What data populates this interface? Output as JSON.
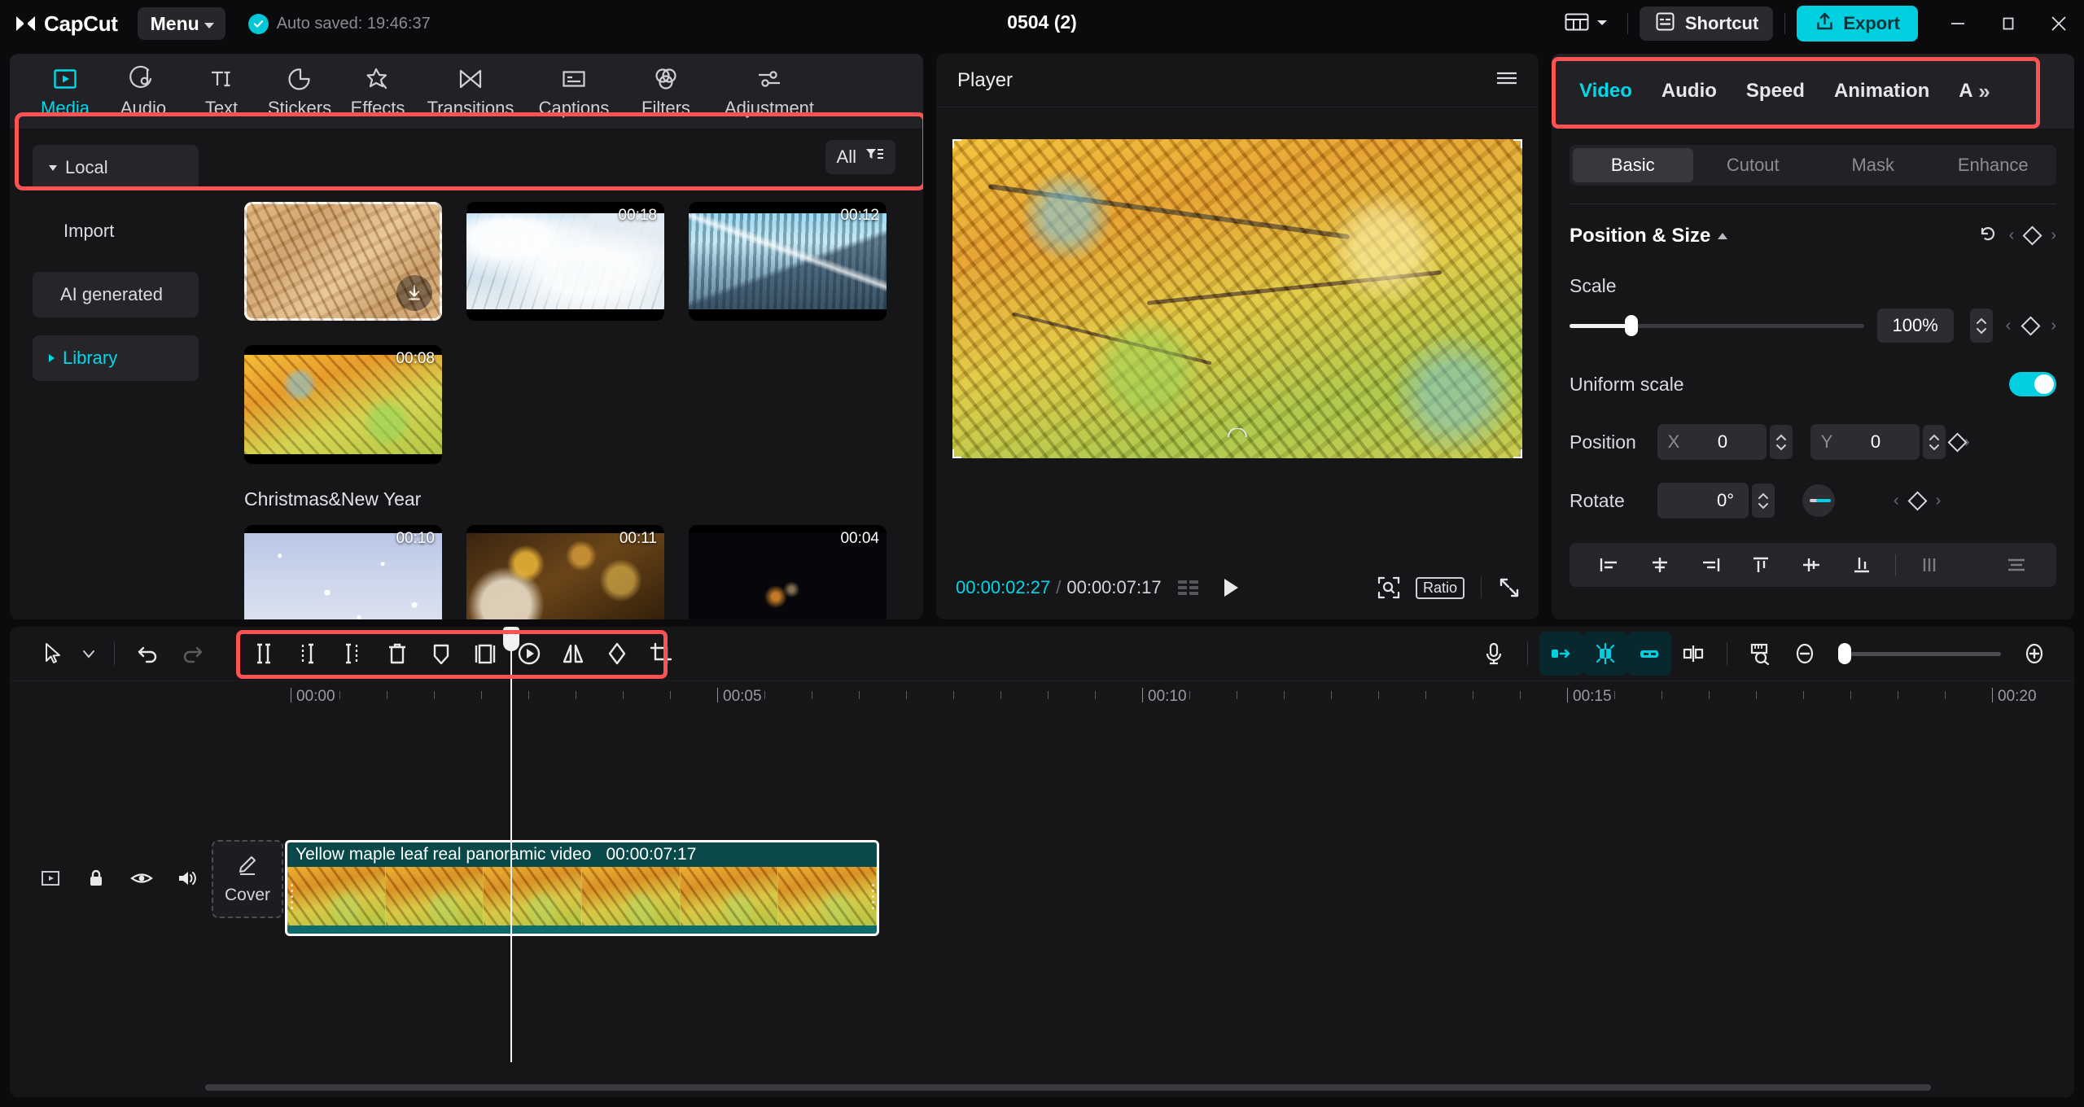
{
  "titlebar": {
    "brand": "CapCut",
    "menu_label": "Menu",
    "autosave_text": "Auto saved: 19:46:37",
    "project_title": "0504 (2)",
    "shortcut_label": "Shortcut",
    "export_label": "Export",
    "layout_icon": "layout-grid-icon",
    "minimize_icon": "minimize-icon",
    "maximize_icon": "maximize-icon",
    "close_icon": "close-icon"
  },
  "media_panel": {
    "highlight_color": "#fb5252",
    "tabs": [
      {
        "label": "Media",
        "icon": "media-play-icon",
        "active": true
      },
      {
        "label": "Audio",
        "icon": "audio-note-icon",
        "active": false
      },
      {
        "label": "Text",
        "icon": "text-ti-icon",
        "active": false
      },
      {
        "label": "Stickers",
        "icon": "sticker-icon",
        "active": false
      },
      {
        "label": "Effects",
        "icon": "effects-star-icon",
        "active": false
      },
      {
        "label": "Transitions",
        "icon": "transitions-bowtie-icon",
        "active": false
      },
      {
        "label": "Captions",
        "icon": "captions-icon",
        "active": false
      },
      {
        "label": "Filters",
        "icon": "filters-circles-icon",
        "active": false
      },
      {
        "label": "Adjustment",
        "icon": "adjustment-sliders-icon",
        "active": false
      }
    ],
    "sidebar": [
      {
        "label": "Local",
        "state": "expanded",
        "style": "box",
        "accent": false
      },
      {
        "label": "Import",
        "state": "none",
        "style": "plain",
        "accent": false
      },
      {
        "label": "AI generated",
        "state": "none",
        "style": "box",
        "accent": false
      },
      {
        "label": "Library",
        "state": "collapsed",
        "style": "box",
        "accent": true
      }
    ],
    "filter": {
      "label": "All",
      "icon": "filter-icon"
    },
    "local_items": [
      {
        "duration": "",
        "thumb": "t-wood",
        "download": true,
        "selected": true
      },
      {
        "duration": "00:18",
        "thumb": "t-snowtree",
        "download": false,
        "selected": false
      },
      {
        "duration": "00:12",
        "thumb": "t-mount",
        "download": false,
        "selected": false
      },
      {
        "duration": "00:08",
        "thumb": "t-maple",
        "download": false,
        "selected": false
      }
    ],
    "category_label": "Christmas&New Year",
    "category_items": [
      {
        "duration": "00:10",
        "thumb": "t-snowfall"
      },
      {
        "duration": "00:11",
        "thumb": "t-bokeh"
      },
      {
        "duration": "00:04",
        "thumb": "t-sparks"
      }
    ]
  },
  "player": {
    "title": "Player",
    "menu_icon": "hamburger-icon",
    "current_time": "00:00:02:27",
    "time_separator": "/",
    "total_time": "00:00:07:17",
    "grid_icon": "frames-grid-icon",
    "play_icon": "play-icon",
    "zoom_fit_icon": "zoom-fit-icon",
    "ratio_label": "Ratio",
    "fullscreen_icon": "fullscreen-icon"
  },
  "properties": {
    "highlight_color": "#fb5252",
    "tabs": [
      {
        "label": "Video",
        "active": true
      },
      {
        "label": "Audio",
        "active": false
      },
      {
        "label": "Speed",
        "active": false
      },
      {
        "label": "Animation",
        "active": false
      },
      {
        "label": "A",
        "active": false
      }
    ],
    "more_icon": "chevron-double-right-icon",
    "subtabs": [
      {
        "label": "Basic",
        "active": true
      },
      {
        "label": "Cutout",
        "active": false
      },
      {
        "label": "Mask",
        "active": false
      },
      {
        "label": "Enhance",
        "active": false
      }
    ],
    "section": {
      "title": "Position & Size",
      "collapse_icon": "chevron-up-icon",
      "reset_icon": "reset-icon",
      "keyframe_icon": "keyframe-diamond-icon"
    },
    "scale": {
      "label": "Scale",
      "value": "100%",
      "slider_percent": 21
    },
    "uniform_scale": {
      "label": "Uniform scale",
      "enabled": true
    },
    "position": {
      "label": "Position",
      "x_axis": "X",
      "x_value": "0",
      "y_axis": "Y",
      "y_value": "0"
    },
    "rotate": {
      "label": "Rotate",
      "value": "0°"
    },
    "align_buttons": [
      "align-left-icon",
      "align-center-horizontal-icon",
      "align-right-icon",
      "align-top-icon",
      "align-middle-vertical-icon",
      "align-bottom-icon",
      "distribute-horizontal-icon",
      "distribute-vertical-icon"
    ]
  },
  "timeline": {
    "highlight_color": "#fb5252",
    "left_tools": [
      {
        "icon": "select-arrow-icon",
        "state": "normal"
      },
      {
        "icon": "chevron-down-small-icon",
        "state": "normal"
      },
      {
        "icon": "undo-icon",
        "state": "normal"
      },
      {
        "icon": "redo-icon",
        "state": "disabled"
      }
    ],
    "edit_tools": [
      "split-icon",
      "delete-left-icon",
      "delete-right-icon",
      "trash-icon",
      "keyframe-marker-icon",
      "crop-frame-icon",
      "speed-curve-icon",
      "mirror-icon",
      "rotate-shape-icon",
      "crop-icon"
    ],
    "right_tools": [
      {
        "icon": "microphone-icon",
        "state": "normal"
      },
      {
        "icon": "snap-left-icon",
        "state": "active"
      },
      {
        "icon": "auto-snap-icon",
        "state": "active-strong"
      },
      {
        "icon": "link-icon",
        "state": "active"
      },
      {
        "icon": "split-playhead-icon",
        "state": "normal"
      },
      {
        "icon": "ruler-zoom-icon",
        "state": "normal"
      },
      {
        "icon": "zoom-out-icon",
        "state": "normal"
      },
      {
        "icon": "zoom-in-icon",
        "state": "normal"
      }
    ],
    "ruler_labels": [
      "00:00",
      "00:05",
      "00:10",
      "00:15",
      "00:20"
    ],
    "playhead_time": "00:00:02:27",
    "track_controls": [
      "track-type-icon",
      "lock-icon",
      "eye-icon",
      "volume-icon"
    ],
    "cover": {
      "label": "Cover",
      "icon": "pencil-icon"
    },
    "clip": {
      "name": "Yellow maple leaf real panoramic video",
      "duration": "00:00:07:17"
    }
  }
}
